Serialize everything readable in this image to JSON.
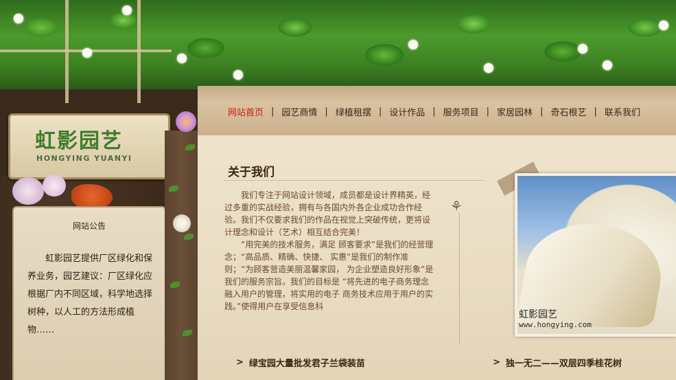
{
  "logo": {
    "name_cn": "虹影园艺",
    "name_en": "HONGYING YUANYI"
  },
  "nav": {
    "items": [
      {
        "label": "网站首页",
        "active": true
      },
      {
        "label": "园艺商情"
      },
      {
        "label": "绿植租摆"
      },
      {
        "label": "设计作品"
      },
      {
        "label": "服务项目"
      },
      {
        "label": "家居园林"
      },
      {
        "label": "奇石根艺"
      },
      {
        "label": "联系我们"
      }
    ],
    "separator": "|",
    "active_color": "#c81f10"
  },
  "notice": {
    "title": "网站公告",
    "text": "虹影园艺提供厂区绿化和保养业务，园艺建议：厂区绿化应根据厂内不同区域，科学地选择树种，以人工的方法形成植物……"
  },
  "about": {
    "title": "关于我们",
    "paragraph1": "我们专注于网站设计领域，成员都是设计界精英，经过多重的实战经验，拥有与各国内外各企业成功合作经验。我们不仅要求我们的作品在视觉上突破传统，更将设计理念和设计（艺术）相互结合完美！",
    "paragraph2": "“用完美的技术服务，满足 顾客要求”是我们的经营理念；“高品质、精确、快捷、 实惠”是我们的制作准则；“为顾客营造美丽温馨家园， 为企业塑造良好形象”是我们的服务宗旨。我们的目标是 “将先进的电子商务理念融入用户的管理，将实用的电子 商务技术应用于用户的实践。”使得用户在享受信息科"
  },
  "photo": {
    "caption_cn": "虹影园艺",
    "caption_url": "www.hongying.com"
  },
  "news": [
    {
      "arrow": ">",
      "text": "绿宝园大量批发君子兰袋装苗"
    },
    {
      "arrow": ">",
      "text": "独一无二——双层四季桂花树"
    }
  ],
  "icons": {
    "butterfly": "butterfly-icon",
    "arrow": "chevron-right-icon"
  }
}
